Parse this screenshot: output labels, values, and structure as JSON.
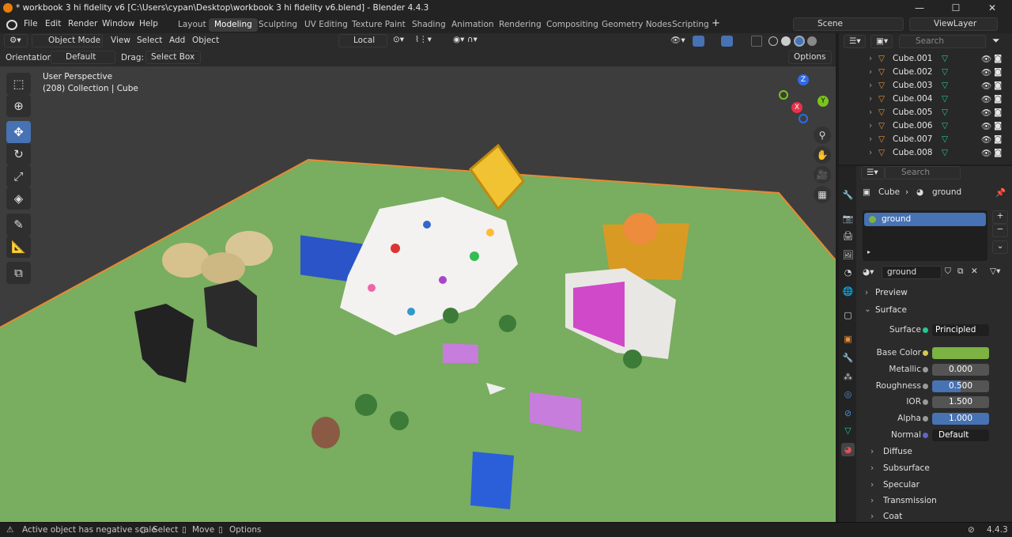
{
  "window": {
    "title": "* workbook 3 hi fidelity v6 [C:\\Users\\cypan\\Desktop\\workbook 3 hi fidelity v6.blend] - Blender 4.4.3",
    "minimize": "—",
    "maximize": "☐",
    "close": "✕"
  },
  "menu": {
    "items": [
      "File",
      "Edit",
      "Render",
      "Window",
      "Help"
    ]
  },
  "workspaces": [
    "Layout",
    "Modeling",
    "Sculpting",
    "UV Editing",
    "Texture Paint",
    "Shading",
    "Animation",
    "Rendering",
    "Compositing",
    "Geometry Nodes",
    "Scripting"
  ],
  "active_workspace": "Modeling",
  "scene": {
    "label": "Scene",
    "view_layer": "ViewLayer"
  },
  "viewport_header": {
    "mode": "Object Mode",
    "menus": [
      "View",
      "Select",
      "Add",
      "Object"
    ],
    "transform_orientation": "Local",
    "options": "Options"
  },
  "tool_settings": {
    "orientation_label": "Orientation:",
    "orientation_value": "Default",
    "drag_label": "Drag:",
    "drag_value": "Select Box"
  },
  "viewport": {
    "perspective": "User Perspective",
    "collection_info": "(208) Collection | Cube"
  },
  "gizmo": {
    "x": "X",
    "y": "Y",
    "z": "Z"
  },
  "outliner": {
    "search_placeholder": "Search",
    "items": [
      "Cube.001",
      "Cube.002",
      "Cube.003",
      "Cube.004",
      "Cube.005",
      "Cube.006",
      "Cube.007",
      "Cube.008"
    ]
  },
  "properties": {
    "search_placeholder": "Search",
    "breadcrumb_object": "Cube",
    "breadcrumb_material": "ground",
    "material_slot": "ground",
    "material_name": "ground",
    "panel_preview": "Preview",
    "panel_surface": "Surface",
    "surface_label": "Surface",
    "surface_value": "Principled BSDF",
    "base_color_label": "Base Color",
    "base_color": "#7cb342",
    "metallic_label": "Metallic",
    "metallic": "0.000",
    "roughness_label": "Roughness",
    "roughness": "0.500",
    "roughness_fraction": 0.5,
    "ior_label": "IOR",
    "ior": "1.500",
    "alpha_label": "Alpha",
    "alpha": "1.000",
    "normal_label": "Normal",
    "normal_value": "Default",
    "subpanels": [
      "Diffuse",
      "Subsurface",
      "Specular",
      "Transmission",
      "Coat"
    ]
  },
  "status_bar": {
    "message": "Active object has negative scale",
    "select": "Select",
    "move": "Move",
    "options": "Options",
    "version": "4.4.3"
  }
}
